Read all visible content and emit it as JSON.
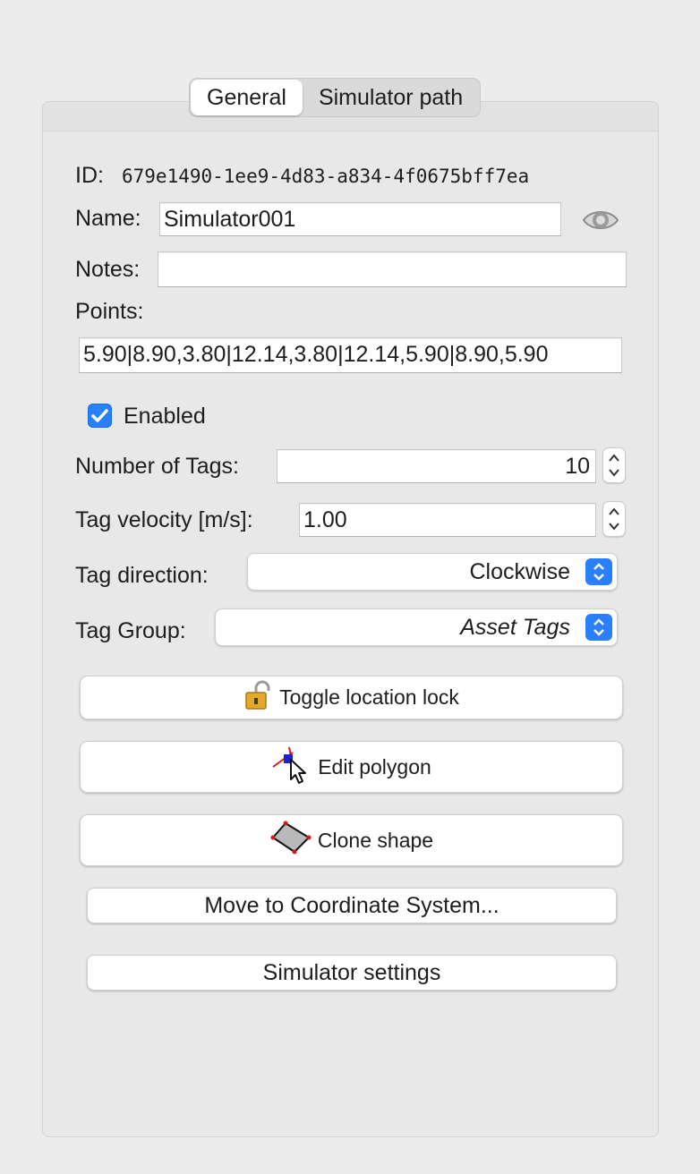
{
  "tabs": [
    {
      "label": "General",
      "active": true
    },
    {
      "label": "Simulator path",
      "active": false
    }
  ],
  "general": {
    "id_label": "ID:",
    "id_value": "679e1490-1ee9-4d83-a834-4f0675bff7ea",
    "name_label": "Name:",
    "name_value": "Simulator001",
    "notes_label": "Notes:",
    "notes_value": "",
    "points_label": "Points:",
    "points_value": "5.90|8.90,3.80|12.14,3.80|12.14,5.90|8.90,5.90",
    "enabled_label": "Enabled",
    "enabled_checked": true,
    "num_tags_label": "Number of Tags:",
    "num_tags_value": "10",
    "velocity_label": "Tag velocity [m/s]:",
    "velocity_value": "1.00",
    "direction_label": "Tag direction:",
    "direction_value": "Clockwise",
    "group_label": "Tag Group:",
    "group_value": "Asset Tags"
  },
  "buttons": {
    "toggle_lock": "Toggle location lock",
    "edit_polygon": "Edit polygon",
    "clone_shape": "Clone shape",
    "move_coord": "Move to Coordinate System...",
    "sim_settings": "Simulator settings"
  },
  "colors": {
    "accent": "#2a7fff",
    "background": "#ececec",
    "panel": "#e8e8e8"
  },
  "icons": {
    "visibility": "eye-icon",
    "lock": "unlocked-padlock-icon",
    "edit": "polygon-cursor-icon",
    "clone": "diamond-shape-icon"
  }
}
